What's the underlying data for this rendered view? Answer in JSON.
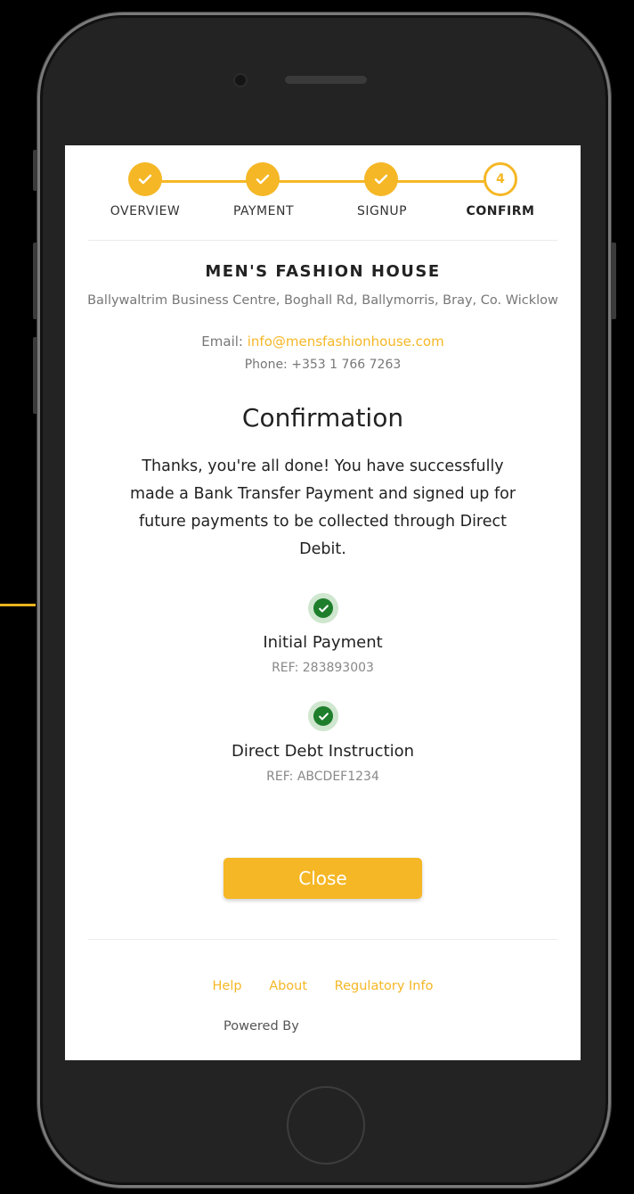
{
  "stepper": {
    "steps": [
      {
        "label": "OVERVIEW",
        "state": "done"
      },
      {
        "label": "PAYMENT",
        "state": "done"
      },
      {
        "label": "SIGNUP",
        "state": "done"
      },
      {
        "label": "CONFIRM",
        "state": "current",
        "number": "4"
      }
    ]
  },
  "merchant": {
    "name": "MEN'S FASHION HOUSE",
    "address": "Ballywaltrim Business Centre, Boghall Rd, Ballymorris, Bray, Co. Wicklow",
    "email_label": "Email:",
    "email": "info@mensfashionhouse.com",
    "phone": "Phone: +353 1 766 7263"
  },
  "confirmation": {
    "title": "Confirmation",
    "message": "Thanks, you're all done! You have successfully made a Bank Transfer Payment and signed up for future payments to be collected through Direct Debit.",
    "items": [
      {
        "title": "Initial Payment",
        "ref": "REF: 283893003"
      },
      {
        "title": "Direct Debt Instruction",
        "ref": "REF: ABCDEF1234"
      }
    ]
  },
  "actions": {
    "close_label": "Close"
  },
  "footer": {
    "links": [
      "Help",
      "About",
      "Regulatory Info"
    ],
    "powered_by": "Powered By"
  },
  "colors": {
    "accent": "#f5b725",
    "success": "#1e7e2c",
    "success_bg": "#cfe6cf"
  }
}
